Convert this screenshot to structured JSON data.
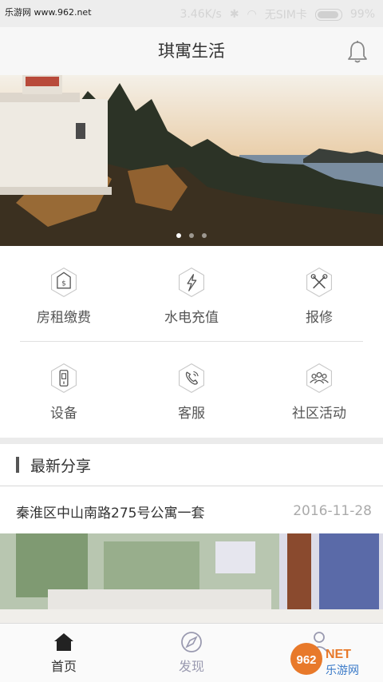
{
  "statusbar": {
    "watermark": "乐游网 www.962.net",
    "speed": "3.46K/s",
    "sim": "无SIM卡",
    "battery": "99%",
    "battery_level": 0.99
  },
  "header": {
    "title": "琪寓生活"
  },
  "banner": {
    "page_count": 3,
    "active_page": 1
  },
  "services": [
    {
      "label": "房租缴费",
      "icon": "house-payment-icon"
    },
    {
      "label": "水电充值",
      "icon": "lightning-icon"
    },
    {
      "label": "报修",
      "icon": "repair-tools-icon"
    },
    {
      "label": "设备",
      "icon": "door-lock-icon"
    },
    {
      "label": "客服",
      "icon": "phone-icon"
    },
    {
      "label": "社区活动",
      "icon": "community-people-icon"
    }
  ],
  "section": {
    "title": "最新分享"
  },
  "post": {
    "title": "秦淮区中山南路275号公寓一套",
    "date": "2016-11-28"
  },
  "tabbar": [
    {
      "label": "首页",
      "icon": "home-icon",
      "active": true
    },
    {
      "label": "发现",
      "icon": "compass-icon",
      "active": false
    },
    {
      "label": "",
      "icon": "user-icon",
      "active": false
    }
  ],
  "colors": {
    "accent": "#333333",
    "inactive": "#9a9ab0"
  },
  "logo": {
    "text": "962",
    "suffix": "NET",
    "caption": "乐游网"
  }
}
